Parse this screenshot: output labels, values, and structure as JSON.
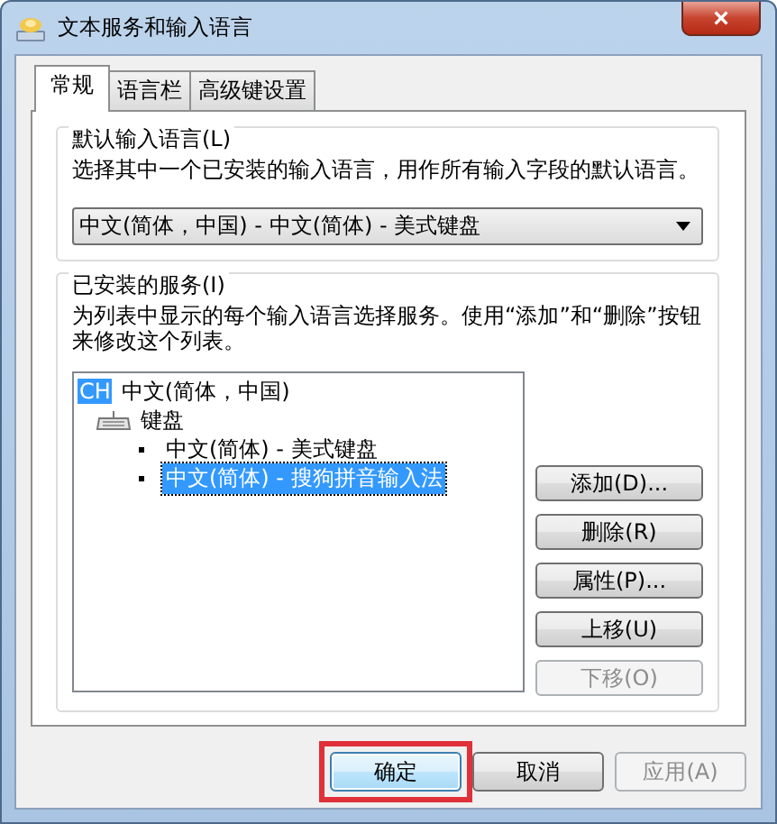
{
  "window": {
    "title": "文本服务和输入语言",
    "close": "×"
  },
  "tabs": [
    {
      "label": "常规",
      "selected": true
    },
    {
      "label": "语言栏",
      "selected": false
    },
    {
      "label": "高级键设置",
      "selected": false
    }
  ],
  "default_language": {
    "label": "默认输入语言(L)",
    "description": "选择其中一个已安装的输入语言，用作所有输入字段的默认语言。",
    "dropdown": {
      "value": "中文(简体，中国) - 中文(简体) - 美式键盘"
    }
  },
  "installed_services": {
    "label": "已安装的服务(I)",
    "description": "为列表中显示的每个输入语言选择服务。使用“添加”和“删除”按钮来修改这个列表。",
    "tree": [
      {
        "badge": "CH",
        "label": "中文(简体，中国)",
        "children": [
          {
            "label": "键盘",
            "children": [
              {
                "label": "中文(简体) - 美式键盘",
                "selected": false
              },
              {
                "label": "中文(简体) - 搜狗拼音输入法",
                "selected": true
              }
            ]
          }
        ]
      }
    ],
    "buttons": [
      {
        "label": "添加(D)...",
        "disabled": false
      },
      {
        "label": "删除(R)",
        "disabled": false
      },
      {
        "label": "属性(P)...",
        "disabled": false
      },
      {
        "label": "上移(U)",
        "disabled": false
      },
      {
        "label": "下移(O)",
        "disabled": true
      }
    ]
  },
  "footer_buttons": [
    {
      "label": "确定",
      "disabled": false,
      "default": true,
      "highlighted": true
    },
    {
      "label": "取消",
      "disabled": false,
      "default": false,
      "highlighted": false
    },
    {
      "label": "应用(A)",
      "disabled": true,
      "default": false,
      "highlighted": false
    }
  ]
}
